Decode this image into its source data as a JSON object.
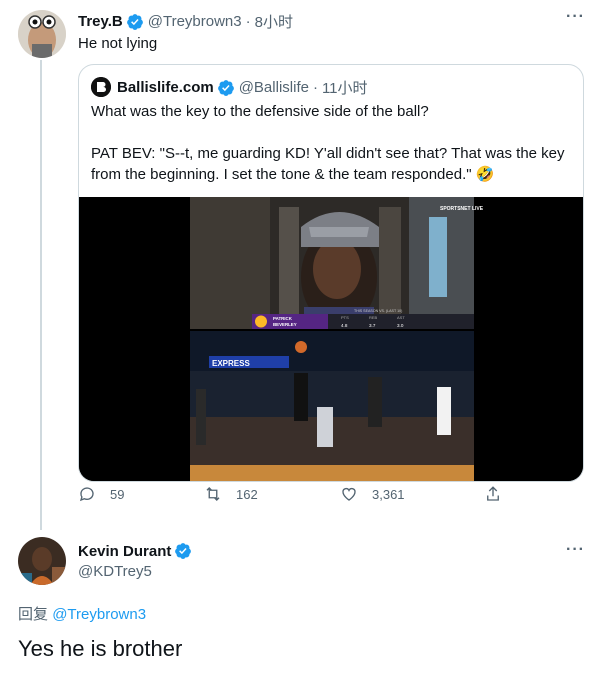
{
  "tweet1": {
    "name": "Trey.B",
    "handle": "@Treybrown3",
    "time": "8小时",
    "text": "He not lying"
  },
  "quote": {
    "name": "Ballislife.com",
    "handle": "@Ballislife",
    "time": "11小时",
    "line1": "What was the key to the defensive side of the ball?",
    "line2": "PAT BEV: \"S--t, me guarding KD! Y'all didn't see that? That was the key from the beginning. I set the tone & the team responded.\" 🤣",
    "media": {
      "broadcast": "SPORTSNET LIVE",
      "stat_header": "THIS SEASON VS. (LAST 10)",
      "player_first": "PATRICK",
      "player_last": "BEVERLEY",
      "stat_labels": [
        "PTS",
        "REB",
        "AST"
      ],
      "stat_values": [
        "4.8",
        "3.7",
        "3.0"
      ],
      "arena_sign": "EXPRESS"
    }
  },
  "actions": {
    "replies": "59",
    "retweets": "162",
    "likes": "3,361"
  },
  "tweet2": {
    "name": "Kevin Durant",
    "handle": "@KDTrey5",
    "reply_prefix": "回复",
    "reply_handle": "@Treybrown3",
    "text": "Yes he is brother"
  },
  "colors": {
    "accent": "#1d9bf0",
    "muted": "#536471",
    "border": "#cfd9de"
  }
}
